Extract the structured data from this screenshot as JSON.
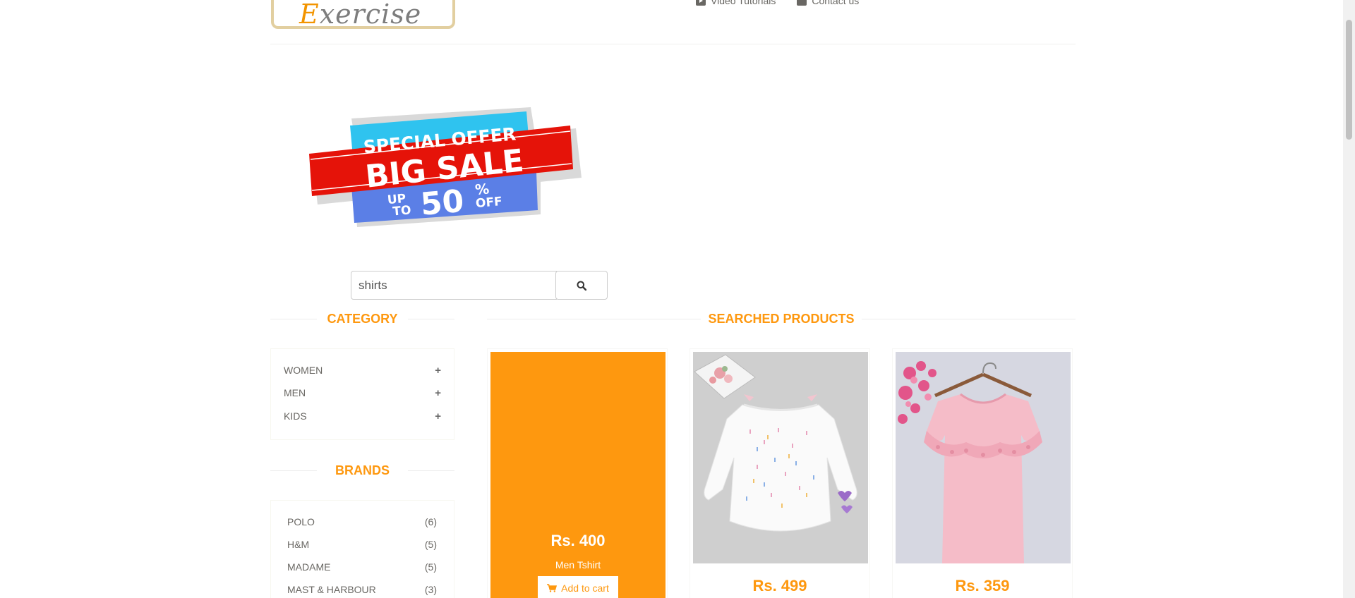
{
  "header": {
    "logo_first": "E",
    "logo_rest": "xercise",
    "nav": [
      {
        "label": "Video Tutorials",
        "icon": "youtube-play-icon"
      },
      {
        "label": "Contact us",
        "icon": "envelope-icon"
      }
    ]
  },
  "banner": {
    "line1": "SPECIAL OFFER",
    "line2": "BIG SALE",
    "up": "UP",
    "to": "TO",
    "amount": "50",
    "percent": "%",
    "off": "OFF"
  },
  "search": {
    "value": "shirts",
    "icon": "search-icon"
  },
  "category": {
    "title": "CATEGORY",
    "items": [
      {
        "label": "WOMEN",
        "icon": "plus-icon"
      },
      {
        "label": "MEN",
        "icon": "plus-icon"
      },
      {
        "label": "KIDS",
        "icon": "plus-icon"
      }
    ]
  },
  "brands": {
    "title": "BRANDS",
    "items": [
      {
        "label": "POLO",
        "count": "(6)"
      },
      {
        "label": "H&M",
        "count": "(5)"
      },
      {
        "label": "MADAME",
        "count": "(5)"
      },
      {
        "label": "MAST & HARBOUR",
        "count": "(3)"
      }
    ]
  },
  "products": {
    "title": "SEARCHED PRODUCTS",
    "items": [
      {
        "price": "Rs. 400",
        "name": "Men Tshirt",
        "cart_label": "Add to cart"
      },
      {
        "price": "Rs. 499"
      },
      {
        "price": "Rs. 359"
      }
    ]
  },
  "colors": {
    "accent": "#fe980f",
    "banner_cyan": "#2fc3ef",
    "banner_red": "#e51309",
    "banner_blue": "#5b7fe6"
  }
}
